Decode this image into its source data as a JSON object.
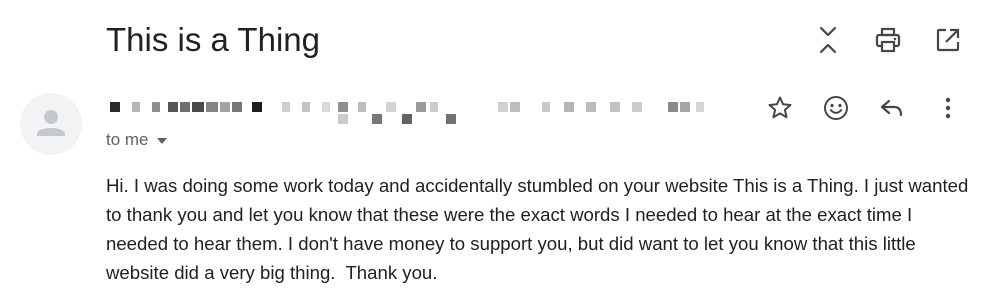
{
  "email": {
    "subject": "This is a Thing",
    "recipient_label": "to me",
    "body": "Hi. I was doing some work today and accidentally stumbled on your website This is a Thing. I just wanted to thank you and let you know that these were the exact words I needed to hear at the exact time I needed to hear them. I don't have money to support you, but did want to let you know that this little website did a very big thing.  Thank you."
  },
  "toolbar": {
    "icons": [
      "collapse-icon",
      "print-icon",
      "open-in-new-window-icon"
    ]
  },
  "message_actions": {
    "icons": [
      "star-icon",
      "emoji-icon",
      "reply-icon",
      "more-vert-icon"
    ]
  },
  "colors": {
    "text": "#202124",
    "secondary_text": "#5f6368",
    "avatar_bg": "#f1f3f4",
    "avatar_fg": "#c6c9cc"
  }
}
